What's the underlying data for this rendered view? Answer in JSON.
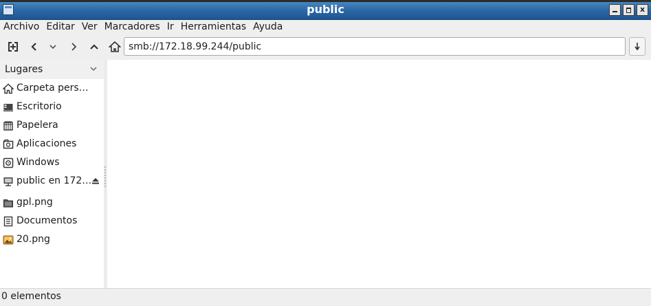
{
  "window": {
    "title": "public"
  },
  "menu": [
    "Archivo",
    "Editar",
    "Ver",
    "Marcadores",
    "Ir",
    "Herramientas",
    "Ayuda"
  ],
  "toolbar": {
    "buttons": [
      "new-tab-icon",
      "back-icon",
      "down-chevron-icon",
      "forward-icon",
      "up-icon",
      "home-icon"
    ],
    "address": "smb://172.18.99.244/public"
  },
  "sidebar": {
    "header": "Lugares",
    "items": [
      {
        "label": "Carpeta pers…",
        "icon": "home-icon"
      },
      {
        "label": "Escritorio",
        "icon": "desktop-icon"
      },
      {
        "label": "Papelera",
        "icon": "trash-icon"
      },
      {
        "label": "Aplicaciones",
        "icon": "applications-icon"
      },
      {
        "label": "Windows",
        "icon": "drive-icon"
      },
      {
        "label": "public en 172…",
        "icon": "network-drive-icon"
      },
      {
        "label": "gpl.png",
        "icon": "folder-icon"
      },
      {
        "label": "Documentos",
        "icon": "document-icon"
      },
      {
        "label": "20.png",
        "icon": "image-icon"
      }
    ]
  },
  "status": {
    "text": "0 elementos"
  },
  "colors": {
    "titlebar": "#2a67a6",
    "sidebar": "#ffffff",
    "window_bg": "#efefef"
  }
}
